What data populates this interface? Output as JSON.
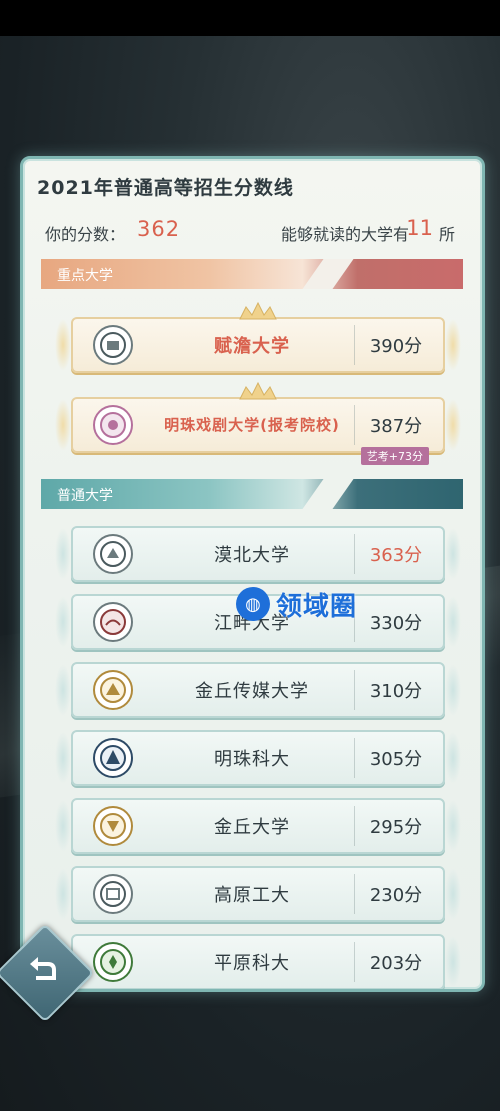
{
  "title": "2021年普通高等招生分数线",
  "score_label": "你的分数：",
  "score_value": "362",
  "count_prefix": "能够就读的大学有",
  "count_value": "11",
  "count_suffix": "所",
  "sections": {
    "key": "重点大学",
    "general": "普通大学"
  },
  "key_universities": [
    {
      "name": "赋澹大学",
      "score": "390分",
      "logo": "university-seal-icon"
    },
    {
      "name": "明珠戏剧大学(报考院校)",
      "score": "387分",
      "badge": "艺考+73分",
      "logo": "drama-seal-icon"
    }
  ],
  "general_universities": [
    {
      "name": "漠北大学",
      "score": "363分"
    },
    {
      "name": "江畔大学",
      "score": "330分"
    },
    {
      "name": "金丘传媒大学",
      "score": "310分"
    },
    {
      "name": "明珠科大",
      "score": "305分"
    },
    {
      "name": "金丘大学",
      "score": "295分"
    },
    {
      "name": "高原工大",
      "score": "230分"
    },
    {
      "name": "平原科大",
      "score": "203分"
    }
  ],
  "watermark": "领域圈",
  "colors": {
    "accent_red": "#d9614e",
    "panel_border": "#7fb6b2",
    "badge": "#b5709c"
  }
}
